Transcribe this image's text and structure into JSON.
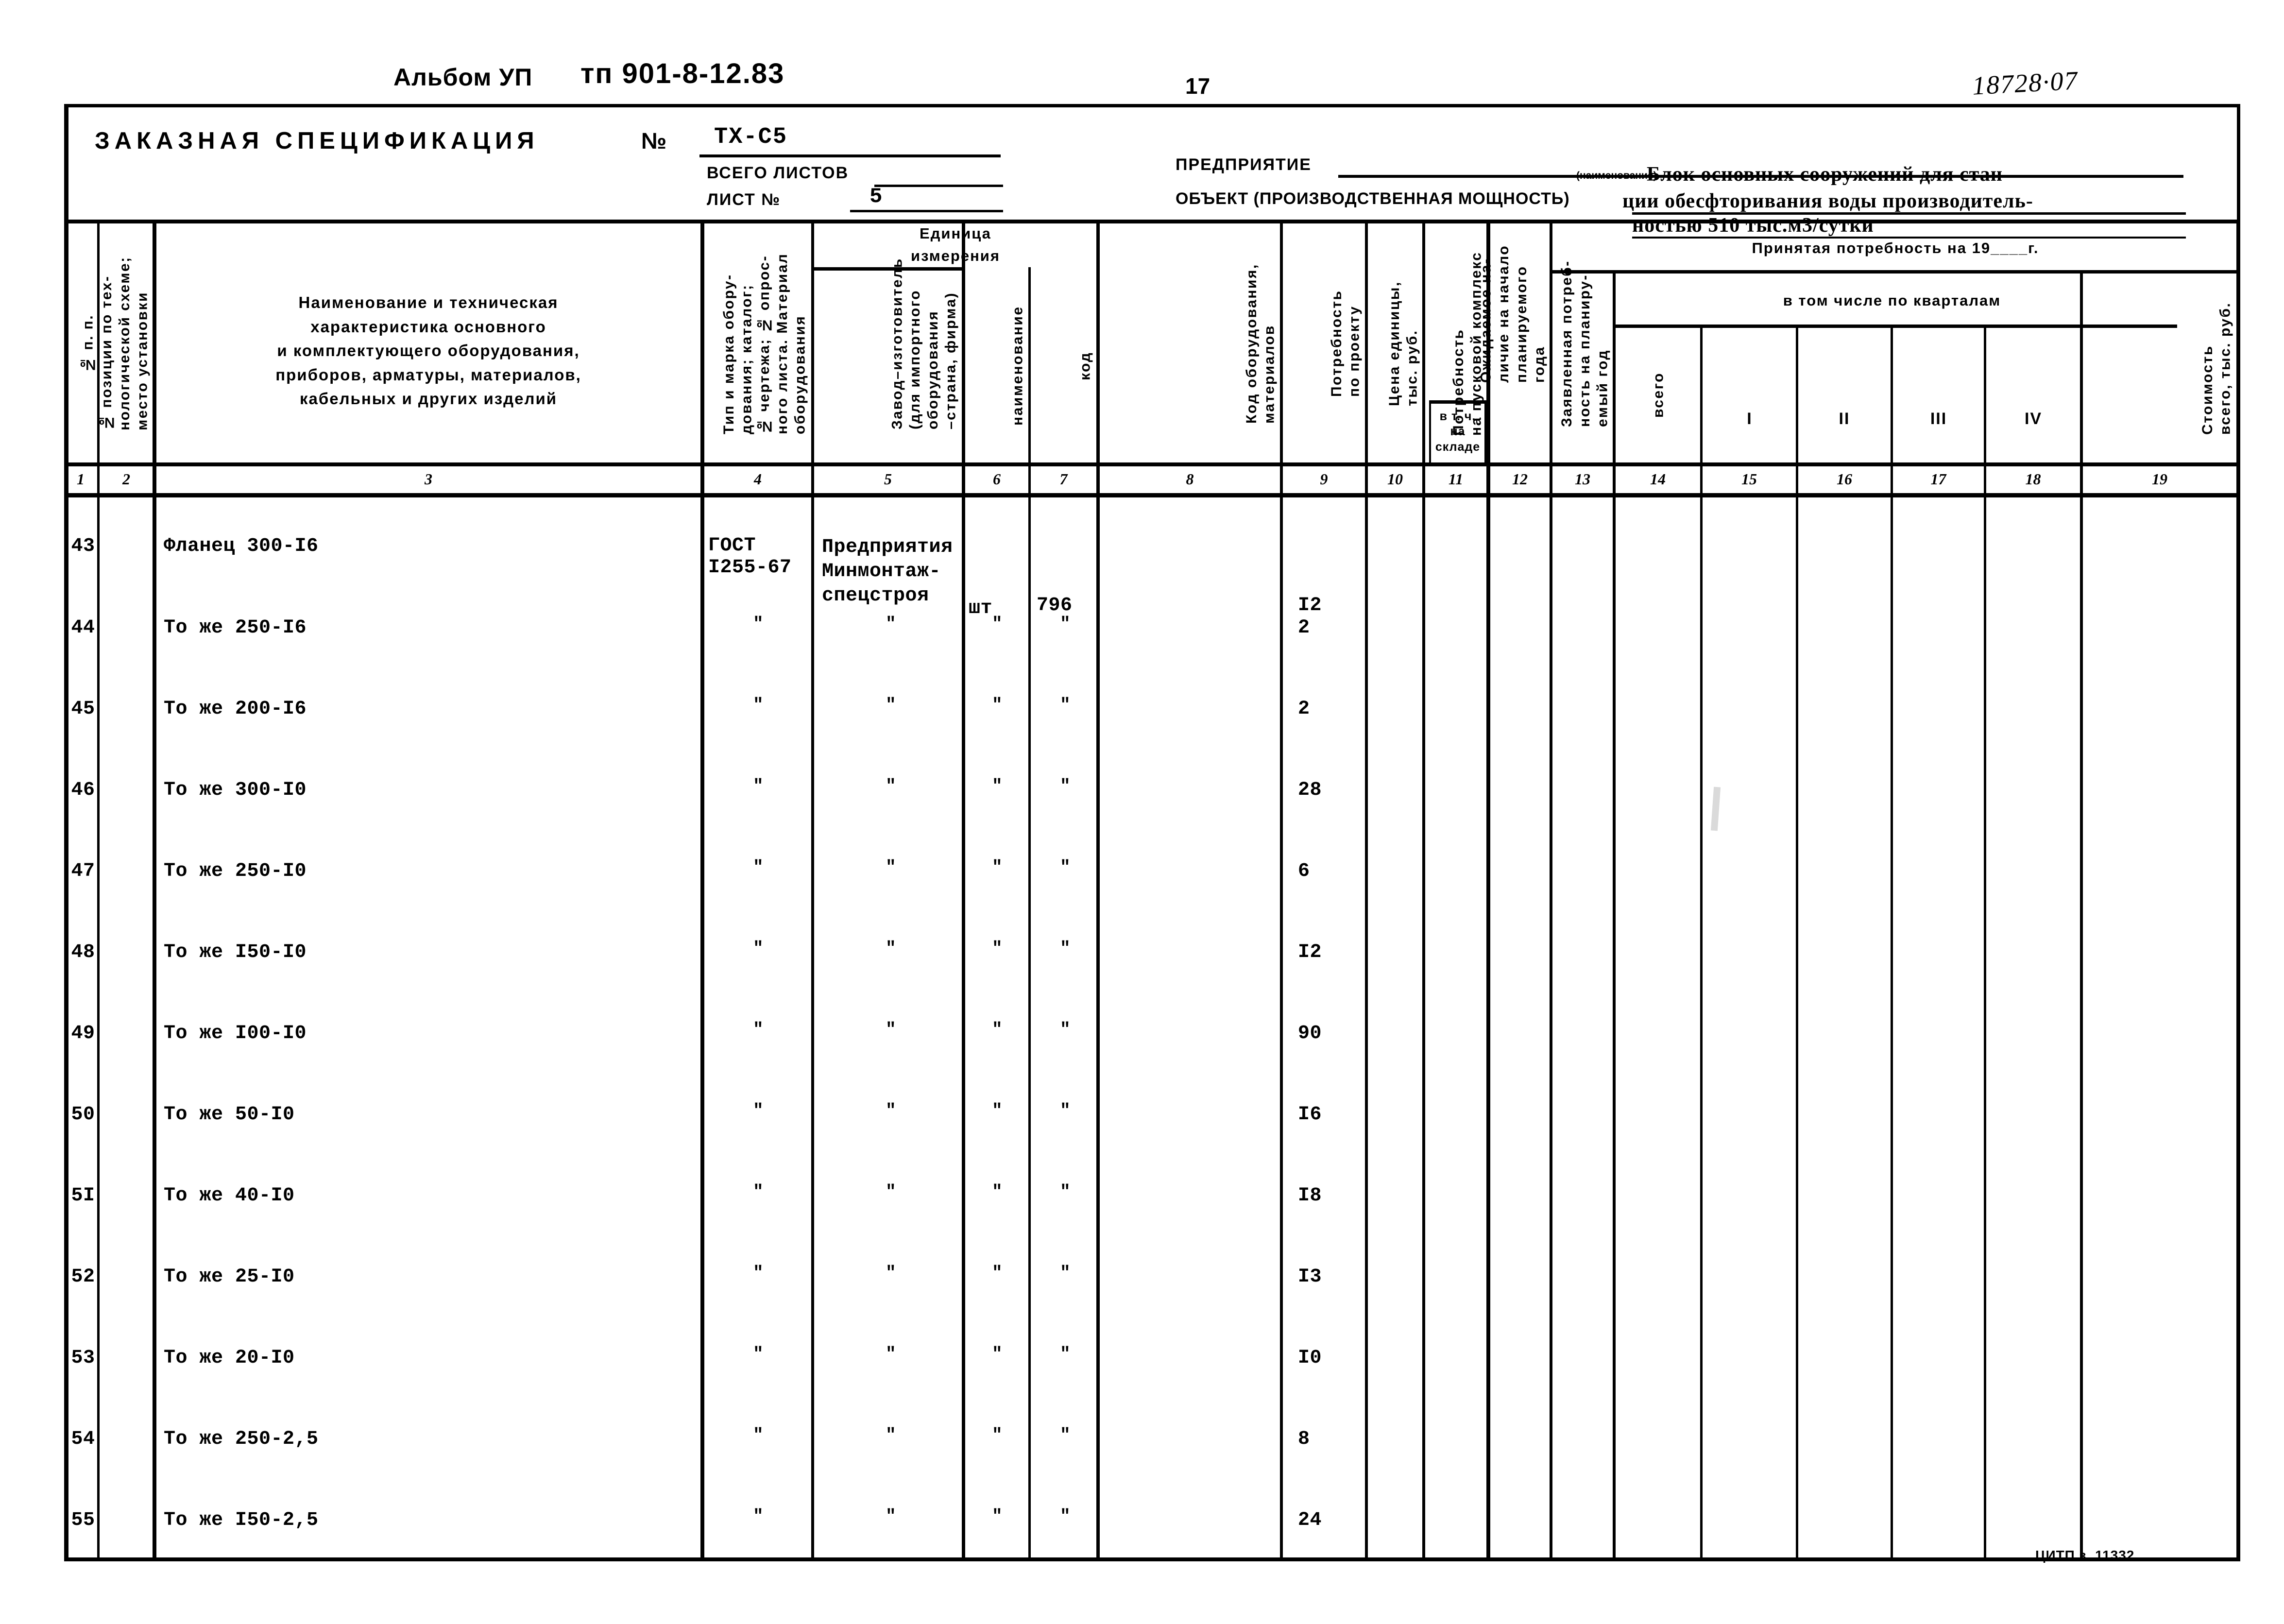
{
  "header": {
    "album": "Альбом УП",
    "tp_code": "тп 901-8-12.83",
    "page_number": "17",
    "archive_number": "18728·07"
  },
  "title_block": {
    "title": "ЗАКАЗНАЯ СПЕЦИФИКАЦИЯ",
    "no_symbol": "№",
    "spec_number": "ТХ-С5",
    "total_sheets_label": "ВСЕГО ЛИСТОВ",
    "total_sheets_value": "",
    "sheet_label": "ЛИСТ №",
    "sheet_value": "5",
    "enterprise_label": "ПРЕДПРИЯТИЕ",
    "enterprise_hint": "(наименование)",
    "object_label": "ОБЪЕКТ (ПРОИЗВОДСТВЕННАЯ МОЩНОСТЬ)",
    "object_line1": "Блок основных сооружений для стан-",
    "object_line2": "ции обесфторивания воды производитель-",
    "object_line3": "ностью 510 тыс.м3/сутки"
  },
  "columns": {
    "c1": "№ п. п.",
    "c2": "№ позиции по тех-\nнологической схеме;\nместо установки",
    "c3": "Наименование и техническая\nхарактеристика основного\nи комплектующего оборудования,\nприборов, арматуры, материалов,\nкабельных и других изделий",
    "c4": "Тип и марка обору-\nдования; каталог;\n№ чертежа; № опрос-\nного листа. Материал\nоборудования",
    "c5": "Завод–изготовитель\n(для импортного\nоборудования\n–страна, фирма)",
    "unit_group": "Единица\nизмерения",
    "c6": "наименование",
    "c7": "код",
    "c8": "Код оборудования,\nматериалов",
    "c9": "Потребность\nпо проекту",
    "c10": "Цена единицы,\nтыс. руб.",
    "c11": "Потребность\nна пусковой комплекс",
    "c12": "Ожидаемое на-\nличие на начало\nпланируемого\nгода",
    "c12_sub": "в т. ч.\nна\nскладе",
    "c13": "Заявленная потреб-\nность на планиру-\nемый год",
    "accepted_group": "Принятая потребность на 19____г.",
    "c14": "всего",
    "quarters_group": "в том числе по кварталам",
    "c15": "I",
    "c16": "II",
    "c17": "III",
    "c18": "IV",
    "c19": "Стоимость\nвсего, тыс. руб."
  },
  "column_numbers": [
    "1",
    "2",
    "3",
    "4",
    "5",
    "6",
    "7",
    "8",
    "9",
    "10",
    "11",
    "12",
    "13",
    "14",
    "15",
    "16",
    "17",
    "18",
    "19"
  ],
  "rows": [
    {
      "no": "43",
      "name": "Фланец 300-I6",
      "type": "ГОСТ\nI255-67",
      "maker": "Предприятия\nМинмонтаж-\nспецстроя",
      "unit": "шт",
      "code": "796",
      "qty": "I2"
    },
    {
      "no": "44",
      "name": "То же 250-I6",
      "type": "\"",
      "maker": "\"",
      "unit": "\"",
      "code": "\"",
      "qty": "2"
    },
    {
      "no": "45",
      "name": "То же 200-I6",
      "type": "\"",
      "maker": "\"",
      "unit": "\"",
      "code": "\"",
      "qty": "2"
    },
    {
      "no": "46",
      "name": "То же 300-I0",
      "type": "\"",
      "maker": "\"",
      "unit": "\"",
      "code": "\"",
      "qty": "28"
    },
    {
      "no": "47",
      "name": "То же 250-I0",
      "type": "\"",
      "maker": "\"",
      "unit": "\"",
      "code": "\"",
      "qty": "6"
    },
    {
      "no": "48",
      "name": "То же I50-I0",
      "type": "\"",
      "maker": "\"",
      "unit": "\"",
      "code": "\"",
      "qty": "I2"
    },
    {
      "no": "49",
      "name": "То же I00-I0",
      "type": "\"",
      "maker": "\"",
      "unit": "\"",
      "code": "\"",
      "qty": "90"
    },
    {
      "no": "50",
      "name": "То же 50-I0",
      "type": "\"",
      "maker": "\"",
      "unit": "\"",
      "code": "\"",
      "qty": "I6"
    },
    {
      "no": "5I",
      "name": "То же 40-I0",
      "type": "\"",
      "maker": "\"",
      "unit": "\"",
      "code": "\"",
      "qty": "I8"
    },
    {
      "no": "52",
      "name": "То же 25-I0",
      "type": "\"",
      "maker": "\"",
      "unit": "\"",
      "code": "\"",
      "qty": "I3"
    },
    {
      "no": "53",
      "name": "То же 20-I0",
      "type": "\"",
      "maker": "\"",
      "unit": "\"",
      "code": "\"",
      "qty": "I0"
    },
    {
      "no": "54",
      "name": "То же 250-2,5",
      "type": "\"",
      "maker": "\"",
      "unit": "\"",
      "code": "\"",
      "qty": "8"
    },
    {
      "no": "55",
      "name": "То же I50-2,5",
      "type": "\"",
      "maker": "\"",
      "unit": "\"",
      "code": "\"",
      "qty": "24"
    }
  ],
  "footer": {
    "print_mark": "ЦИТП з. 11332"
  }
}
